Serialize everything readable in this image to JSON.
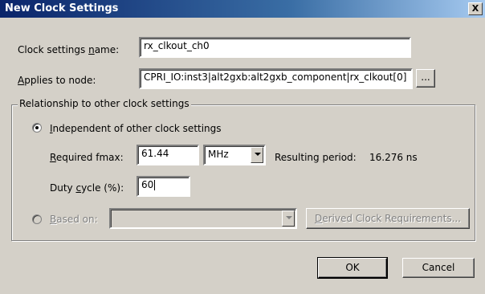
{
  "window": {
    "title": "New Clock Settings",
    "close_label": "X"
  },
  "clock_name": {
    "label_pre": "Clock settings ",
    "label_u": "n",
    "label_post": "ame:",
    "value": "rx_clkout_ch0"
  },
  "applies_to": {
    "label_u": "A",
    "label_post": "pplies to node:",
    "value": "CPRI_IO:inst3|alt2gxb:alt2gxb_component|rx_clkout[0]",
    "browse_label": "..."
  },
  "group": {
    "legend": "Relationship to other clock settings",
    "independent": {
      "label_u": "I",
      "label_post": "ndependent of other clock settings",
      "selected": true
    },
    "fmax": {
      "label_u": "R",
      "label_post": "equired fmax:",
      "value": "61.44",
      "unit": "MHz",
      "period_label": "Resulting period:",
      "period_value": "16.276 ns"
    },
    "duty": {
      "label_pre": "Duty ",
      "label_u": "c",
      "label_post": "ycle (%):",
      "value": "60"
    },
    "based_on": {
      "label_u": "B",
      "label_post": "ased on:",
      "selected": false,
      "derived_label_u": "D",
      "derived_label_post": "erived Clock Requirements..."
    }
  },
  "buttons": {
    "ok": "OK",
    "cancel": "Cancel"
  }
}
